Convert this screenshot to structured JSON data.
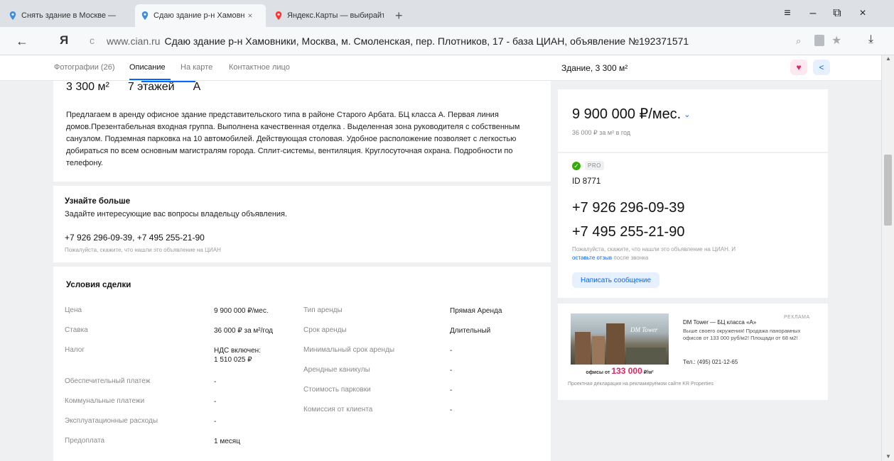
{
  "browser": {
    "tabs": [
      {
        "title": "Снять здание в Москве —",
        "icon": "cian-pin-icon",
        "active": false
      },
      {
        "title": "Сдаю здание р-н Хамовн",
        "icon": "cian-pin-icon",
        "active": true,
        "close": "×"
      },
      {
        "title": "Яндекс.Карты — выбирайте",
        "icon": "yandex-maps-pin-icon",
        "active": false
      }
    ],
    "new_tab": "+",
    "menu_icon": "≡",
    "minimize_icon": "–",
    "restore_icon": "⧉",
    "close_icon": "×",
    "back_icon": "←",
    "yandex_logo": "Я",
    "reload_icon": "c",
    "url_host": "www.cian.ru",
    "url_title": "Сдаю здание р-н Хамовники, Москва, м. Смоленская, пер. Плотников, 17 - база ЦИАН, объявление №192371571",
    "star_icon": "★",
    "download_icon": "⤓",
    "search_icon": "⌕"
  },
  "page_nav": {
    "tabs": [
      "Фотографии (26)",
      "Описание",
      "На карте",
      "Контактное лицо"
    ],
    "active_index": 1,
    "header_title": "Здание, 3 300 м²",
    "heart_icon": "♥",
    "share_icon": "<"
  },
  "summary": {
    "area": "3 300 м²",
    "floors": "7 этажей",
    "class": "А"
  },
  "description": "Предлагаем в аренду офисное здание представительского типа в районе Старого Арбата. БЦ класса А. Первая линия домов.Презентабельная входная группа. Выполнена качественная отделка . Выделенная зона руководителя с собственным санузлом. Подземная парковка на 10 автомобилей. Действующая столовая. Удобное расположение позволяет с легкостью добираться по всем основным магистралям города. Сплит-системы, вентиляция. Круглосуточная охрана. Подробности по телефону.",
  "learn_more": {
    "title": "Узнайте больше",
    "subtitle": "Задайте интересующие вас вопросы владельцу объявления.",
    "phones": "+7 926 296-09-39, +7 495 255-21-90",
    "hint": "Пожалуйста, скажите, что нашли это объявление на ЦИАН"
  },
  "terms": {
    "title": "Условия сделки",
    "left": [
      {
        "label": "Цена",
        "value": "9 900 000 ₽/мес."
      },
      {
        "label": "Ставка",
        "value": "36 000 ₽ за м²/год"
      },
      {
        "label": "Налог",
        "value": "НДС включен:",
        "value2": "1 510 025 ₽"
      },
      {
        "label": "Обеспечительный платеж",
        "value": "-"
      },
      {
        "label": "Коммунальные платежи",
        "value": "-"
      },
      {
        "label": "Эксплуатационные расходы",
        "value": "-"
      },
      {
        "label": "Предоплата",
        "value": "1 месяц"
      }
    ],
    "right": [
      {
        "label": "Тип аренды",
        "value": "Прямая Аренда"
      },
      {
        "label": "Срок аренды",
        "value": "Длительный"
      },
      {
        "label": "Минимальный срок аренды",
        "value": "-"
      },
      {
        "label": "Арендные каникулы",
        "value": "-"
      },
      {
        "label": "Стоимость парковки",
        "value": "-"
      },
      {
        "label": "Комиссия от клиента",
        "value": "-"
      }
    ]
  },
  "price": {
    "main": "9 900 000 ₽/мес.",
    "chevron": "⌄",
    "per_meter": "36 000 ₽ за м² в год"
  },
  "contact": {
    "verified_icon": "✓",
    "badge": "PRO",
    "id": "ID 8771",
    "phone1": "+7 926 296-09-39",
    "phone2": "+7 495 255-21-90",
    "hint": "Пожалуйста, скажите, что нашли это объявление на ЦИАН. И ",
    "hint_link": "оставьте отзыв",
    "hint_tail": " после звонка",
    "write_button": "Написать сообщение"
  },
  "ad": {
    "label": "РЕКЛАМА",
    "image_mark": "DM Tower",
    "offices_from": "офисы от",
    "offices_price": "133 000",
    "offices_unit": "₽/м²",
    "title": "DM Tower — БЦ класса «А»",
    "text": "Выше своего окружения! Продажа панорамных офисов от 133 000 руб/м2! Площади от 68 м2!",
    "phone": "Тел.: (495) 021-12-65",
    "declaration": "Проектная декларация на рекламируемом сайте KR Properties"
  },
  "scrollbar": {
    "up_icon": "▲",
    "down_icon": "▼"
  },
  "colors": {
    "accent": "#0468ff",
    "pink": "#e22460",
    "verified": "#34ac0a"
  }
}
